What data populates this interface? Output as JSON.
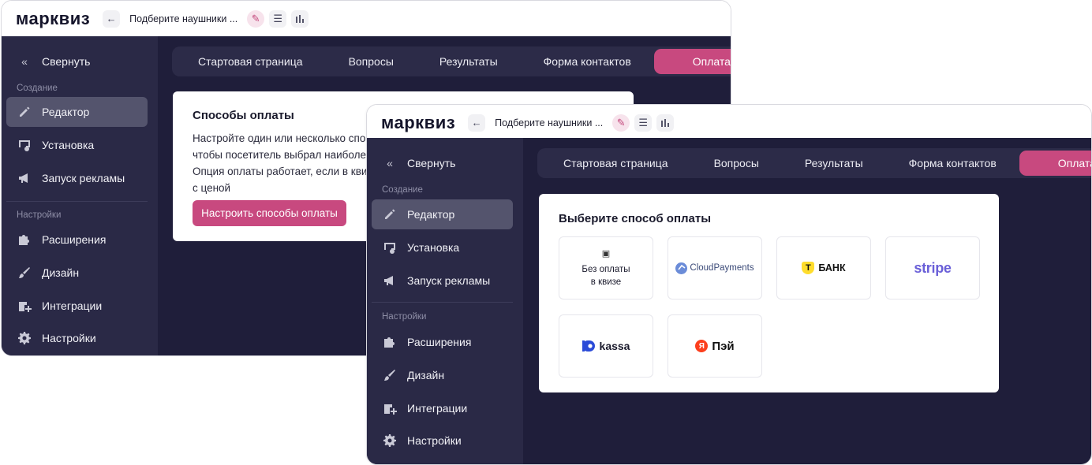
{
  "app": {
    "logo": "марквиз",
    "quiz_name": "Подберите наушники ..."
  },
  "colors": {
    "accent": "#c8497f",
    "dark_bg": "#1f1e3a",
    "sidebar_bg": "#2a2946"
  },
  "icons": {
    "back": "arrow-left-icon",
    "edit": "pencil-icon",
    "list": "list-icon",
    "stats": "bar-chart-icon"
  },
  "sidebar": {
    "collapse_label": "Свернуть",
    "section_create": "Создание",
    "section_settings": "Настройки",
    "items": [
      {
        "label": "Редактор",
        "icon": "pencil-icon"
      },
      {
        "label": "Установка",
        "icon": "install-icon"
      },
      {
        "label": "Запуск рекламы",
        "icon": "megaphone-icon"
      },
      {
        "label": "Расширения",
        "icon": "puzzle-icon"
      },
      {
        "label": "Дизайн",
        "icon": "brush-icon"
      },
      {
        "label": "Интеграции",
        "icon": "integrations-icon"
      },
      {
        "label": "Настройки",
        "icon": "gear-icon"
      }
    ]
  },
  "tabs": [
    {
      "label": "Стартовая страница"
    },
    {
      "label": "Вопросы"
    },
    {
      "label": "Результаты"
    },
    {
      "label": "Форма контактов"
    },
    {
      "label": "Оплата"
    }
  ],
  "back_card": {
    "title": "Способы оплаты",
    "lines": [
      "Настройте один или несколько спос",
      "чтобы посетитель выбрал наиболее",
      "Опция оплаты работает, если в квиз",
      "с ценой"
    ],
    "button": "Настроить способы оплаты"
  },
  "front_card": {
    "title": "Выберите способ оплаты",
    "no_payment_line1": "Без оплаты",
    "no_payment_line2": "в квизе",
    "cloudpayments": "CloudPayments",
    "tbank": "БАНК",
    "tbank_mark": "Т",
    "stripe": "stripe",
    "yookassa": "kassa",
    "yapay": "Пэй",
    "yapay_mark": "Я"
  }
}
